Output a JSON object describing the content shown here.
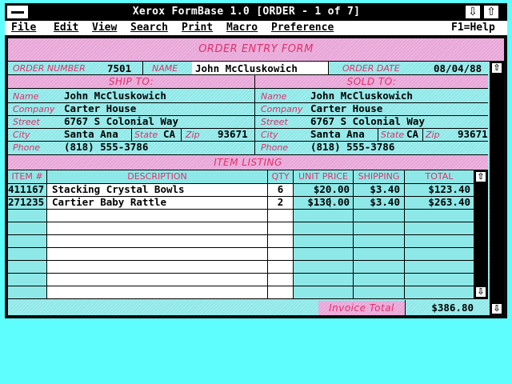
{
  "window": {
    "title": "Xerox FormBase 1.0 [ORDER - 1 of 7]",
    "down_icon": "⇩",
    "up_icon": "⇧"
  },
  "menu": {
    "items": [
      "File",
      "Edit",
      "View",
      "Search",
      "Print",
      "Macro",
      "Preference"
    ],
    "help": "F1=Help"
  },
  "form": {
    "title": "ORDER ENTRY FORM",
    "order_number_label": "ORDER NUMBER",
    "order_number": "7501",
    "name_label": "NAME",
    "name": "John McCluskowich",
    "order_date_label": "ORDER DATE",
    "order_date": "08/04/88",
    "ship_to": {
      "header": "SHIP TO:",
      "name_label": "Name",
      "name": "John McCluskowich",
      "company_label": "Company",
      "company": "Carter House",
      "street_label": "Street",
      "street": "6767 S Colonial Way",
      "city_label": "City",
      "city": "Santa Ana",
      "state_label": "State",
      "state": "CA",
      "zip_label": "Zip",
      "zip": "93671",
      "phone_label": "Phone",
      "phone": "(818) 555-3786"
    },
    "sold_to": {
      "header": "SOLD TO:",
      "name_label": "Name",
      "name": "John McCluskowich",
      "company_label": "Company",
      "company": "Carter House",
      "street_label": "Street",
      "street": "6767 S Colonial Way",
      "city_label": "City",
      "city": "Santa Ana",
      "state_label": "State",
      "state": "CA",
      "zip_label": "Zip",
      "zip": "93671",
      "phone_label": "Phone",
      "phone": "(818) 555-3786"
    },
    "item_listing": {
      "header": "ITEM LISTING",
      "columns": [
        "ITEM #",
        "DESCRIPTION",
        "QTY",
        "UNIT PRICE",
        "SHIPPING",
        "TOTAL"
      ],
      "rows": [
        {
          "item": "411167",
          "description": "Stacking Crystal Bowls",
          "qty": "6",
          "unit_price": "$20.00",
          "shipping": "$3.40",
          "total": "$123.40"
        },
        {
          "item": "271235",
          "description": "Cartier Baby Rattle",
          "qty": "2",
          "unit_price": "$130.00",
          "shipping": "$3.40",
          "total": "$263.40"
        }
      ]
    },
    "invoice_total_label": "Invoice Total",
    "invoice_total": "$386.80"
  }
}
